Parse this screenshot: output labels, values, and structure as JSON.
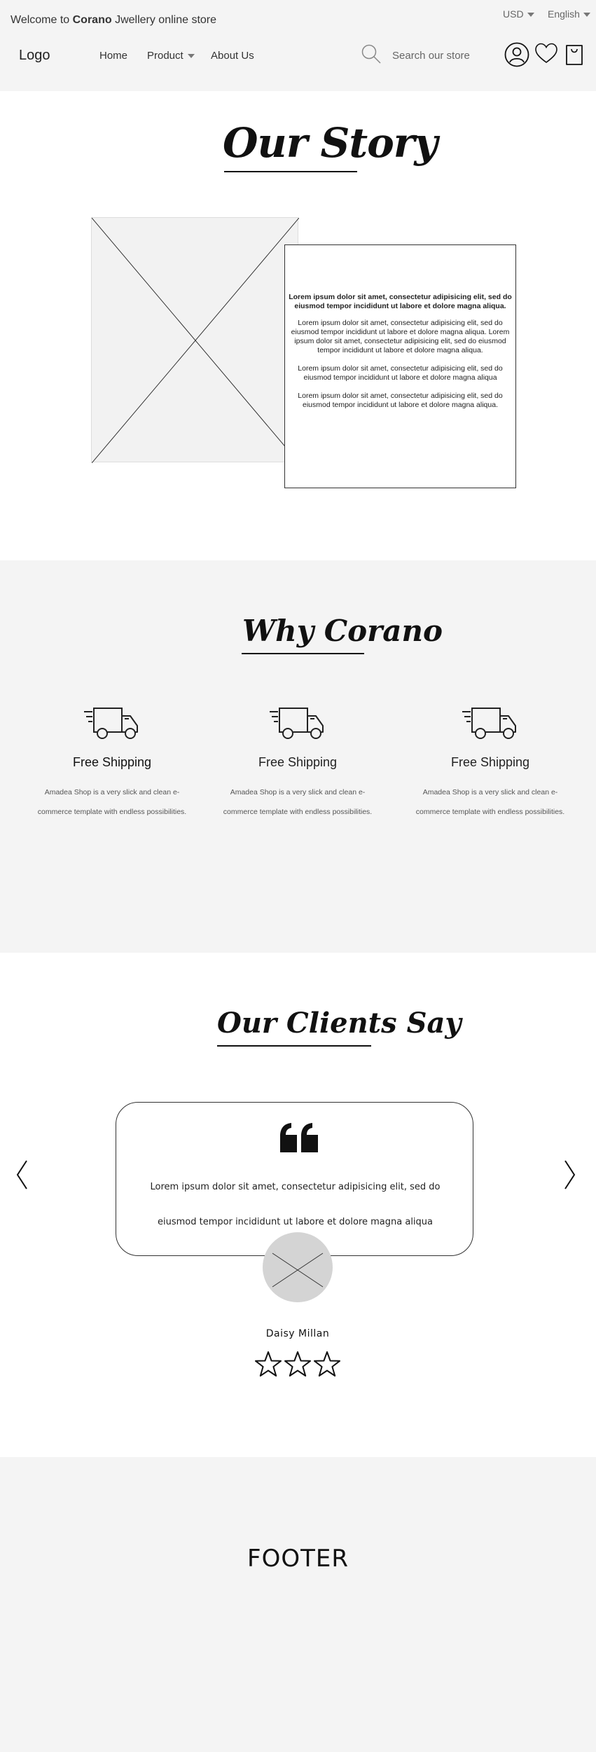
{
  "topbar": {
    "welcome_prefix": "Welcome to ",
    "welcome_brand": "Corano",
    "welcome_suffix": " Jwellery online store",
    "currency": "USD",
    "language": "English"
  },
  "header": {
    "logo": "Logo",
    "nav": [
      {
        "label": "Home"
      },
      {
        "label": "Product"
      },
      {
        "label": "About Us"
      }
    ],
    "search_placeholder": "Search our store",
    "icons": [
      "search-icon",
      "user-icon",
      "heart-icon",
      "shopping-bag-icon"
    ]
  },
  "story": {
    "title": "Our Story",
    "lead": "Lorem ipsum dolor sit amet, consectetur adipisicing elit, sed do eiusmod tempor incididunt ut labore et dolore magna aliqua.",
    "paragraphs": [
      "Lorem ipsum dolor sit amet, consectetur adipisicing elit, sed do eiusmod tempor incididunt ut labore et dolore magna aliqua. Lorem ipsum dolor sit amet, consectetur adipisicing elit, sed do eiusmod tempor incididunt ut labore et dolore magna aliqua.",
      "Lorem ipsum dolor sit amet, consectetur adipisicing elit, sed do eiusmod tempor incididunt ut labore et dolore magna aliqua",
      "Lorem ipsum dolor sit amet, consectetur adipisicing elit, sed do eiusmod tempor incididunt ut labore et dolore magna aliqua."
    ]
  },
  "why": {
    "title": "Why Corano",
    "features": [
      {
        "icon": "truck-icon",
        "title": "Free Shipping",
        "desc": "Amadea Shop is a very slick and clean e-commerce template with endless possibilities."
      },
      {
        "icon": "truck-icon",
        "title": "Free Shipping",
        "desc": "Amadea Shop is a very slick and clean e-commerce template with endless possibilities."
      },
      {
        "icon": "truck-icon",
        "title": "Free Shipping",
        "desc": "Amadea Shop is a very slick and clean e-commerce template with endless possibilities."
      }
    ]
  },
  "clients": {
    "title": "Our Clients Say",
    "quote": "Lorem ipsum dolor sit amet, consectetur adipisicing elit, sed do eiusmod tempor incididunt ut labore et dolore magna aliqua",
    "name": "Daisy Millan",
    "rating": 0,
    "rating_max": 3
  },
  "footer": {
    "label": "FOOTER"
  }
}
